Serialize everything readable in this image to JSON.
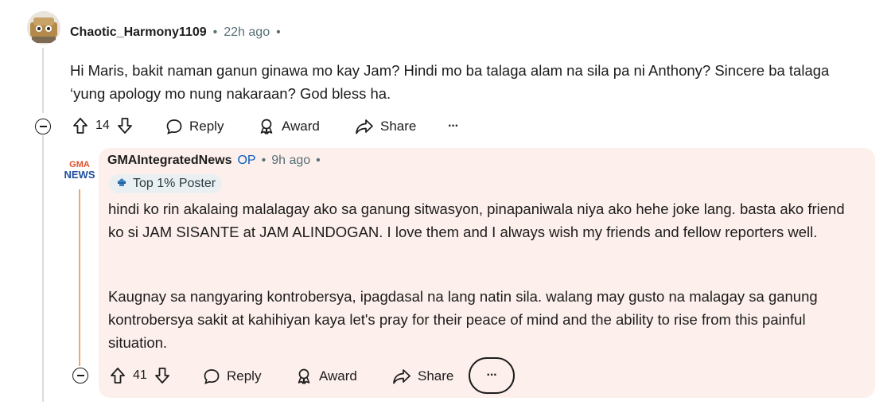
{
  "comment1": {
    "username": "Chaotic_Harmony1109",
    "time": "22h ago",
    "body": "Hi Maris, bakit naman ganun ginawa mo kay Jam? Hindi mo ba talaga alam na sila pa ni Anthony? Sincere ba talaga ‘yung apology mo nung nakaraan? God bless ha.",
    "votes": "14",
    "reply_label": "Reply",
    "award_label": "Award",
    "share_label": "Share",
    "more_label": "···"
  },
  "comment2": {
    "avatar_text_top": "GMA",
    "avatar_text_bottom": "NEWS",
    "username": "GMAIntegratedNews",
    "op_badge": "OP",
    "time": "9h ago",
    "flair": "Top 1% Poster",
    "body_p1": "hindi ko rin akalaing malalagay ako sa ganung sitwasyon, pinapaniwala niya ako hehe joke lang. basta ako friend ko si JAM SISANTE at JAM ALINDOGAN. I love them and I always wish my friends and fellow reporters well.",
    "body_p2": "Kaugnay sa nangyaring kontrobersya, ipagdasal na lang natin sila. walang may gusto na malagay sa ganung kontrobersya sakit at kahihiyan kaya let's pray for their peace of mind and the ability to rise from this painful situation.",
    "votes": "41",
    "reply_label": "Reply",
    "award_label": "Award",
    "share_label": "Share",
    "more_label": "···"
  },
  "separator": "•",
  "colors": {
    "op": "#0a5cc2",
    "highlight_bg": "#fdf0ec",
    "thread_highlight": "#f5a46f",
    "meta": "#576f76"
  },
  "icons": [
    "upvote-icon",
    "downvote-icon",
    "reply-icon",
    "award-icon",
    "share-icon",
    "collapse-icon",
    "more-icon",
    "flair-icon"
  ]
}
